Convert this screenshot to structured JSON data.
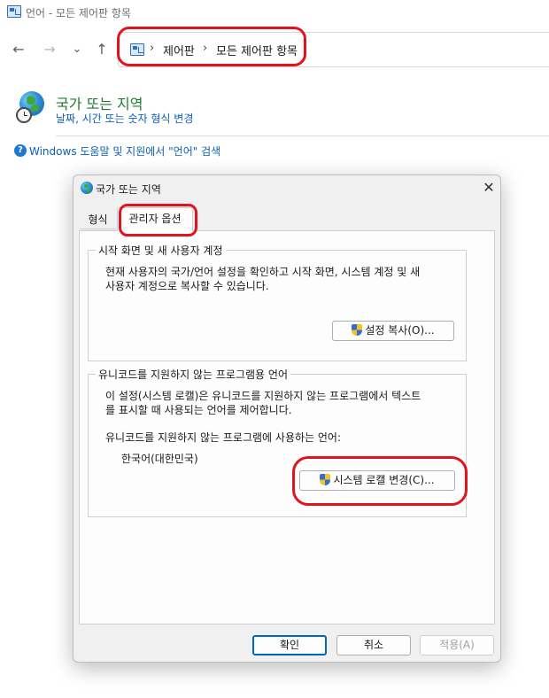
{
  "window": {
    "title": "언어 - 모든 제어판 항목"
  },
  "nav": {
    "back": "←",
    "forward": "→",
    "recent": "⌄",
    "up": "↑",
    "breadcrumb": [
      "제어판",
      "모든 제어판 항목"
    ],
    "separator": "›"
  },
  "header": {
    "title": "국가 또는 지역",
    "link": "날짜, 시간 또는 숫자 형식 변경",
    "help_link": "Windows 도움말 및 지원에서 \"언어\" 검색",
    "help_icon": "?"
  },
  "dialog": {
    "title": "국가 또는 지역",
    "close": "✕",
    "tabs": [
      {
        "label": "형식",
        "selected": false
      },
      {
        "label": "관리자 옵션",
        "selected": true
      }
    ],
    "group1": {
      "caption": "시작 화면 및 새 사용자 계정",
      "text_line1": "현재 사용자의 국가/언어 설정을 확인하고 시작 화면, 시스템 계정 및 새",
      "text_line2": "사용자 계정으로 복사할 수 있습니다.",
      "button": "설정 복사(O)..."
    },
    "group2": {
      "caption": "유니코드를 지원하지 않는 프로그램용 언어",
      "text_line1": "이 설정(시스템 로캘)은 유니코드를 지원하지 않는 프로그램에서 텍스트",
      "text_line2": "를 표시할 때 사용되는 언어를 제어합니다.",
      "current_label": "유니코드를 지원하지 않는 프로그램에 사용하는 언어:",
      "current_value": "한국어(대한민국)",
      "button": "시스템 로캘 변경(C)..."
    },
    "buttons": {
      "ok": "확인",
      "cancel": "취소",
      "apply": "적용(A)"
    }
  },
  "colors": {
    "highlight": "#e1141e",
    "link": "#0b5fb8",
    "heading": "#1e7a2f",
    "accent": "#0067c0"
  }
}
